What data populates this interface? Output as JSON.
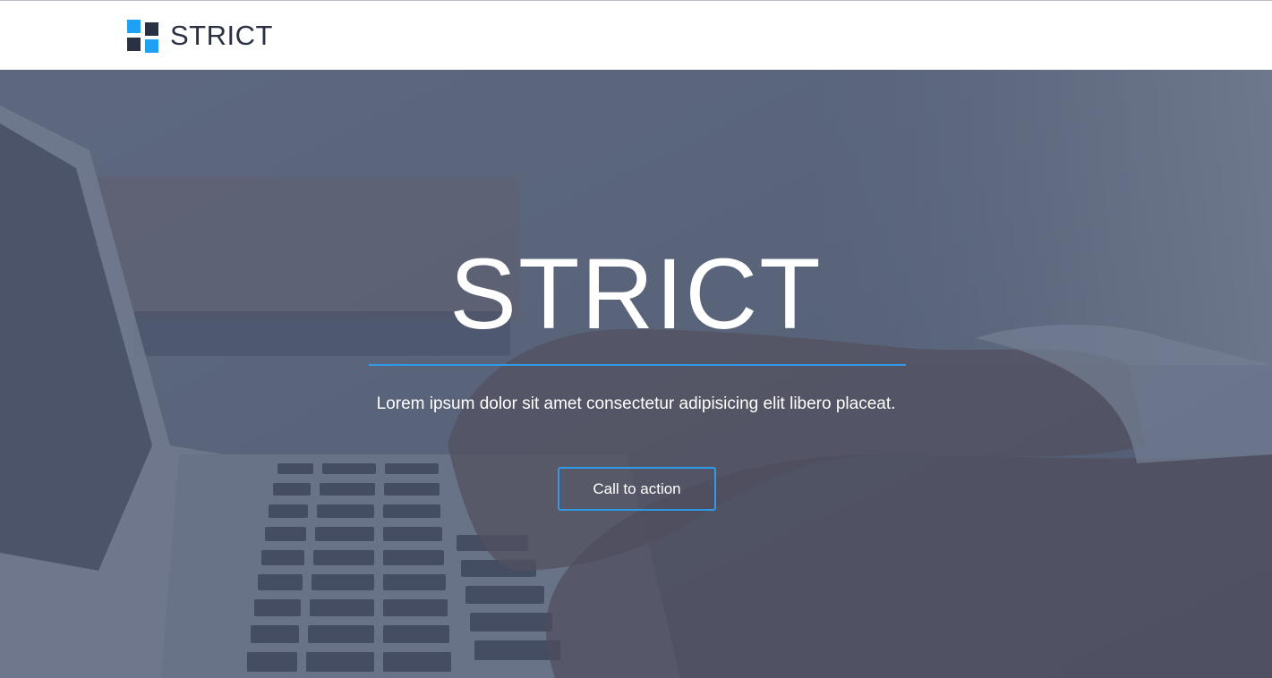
{
  "navbar": {
    "brand_name": "STRICT",
    "logo_icon": "four-squares-logo-icon"
  },
  "hero": {
    "title": "STRICT",
    "subtitle": "Lorem ipsum dolor sit amet consectetur adipisicing elit libero placeat.",
    "cta_label": "Call to action",
    "background_image": "hands-typing-on-laptop-photo"
  },
  "colors": {
    "accent": "#1ea1f2",
    "dark": "#2a3142",
    "divider": "#2f9ae8",
    "overlay": "#5d6579"
  }
}
